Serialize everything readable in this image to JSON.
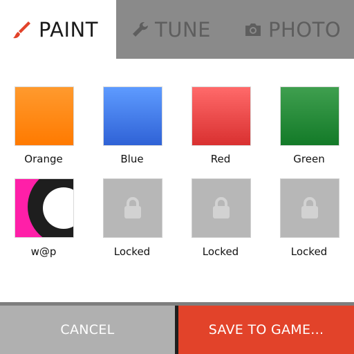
{
  "tabs": [
    {
      "label": "PAINT",
      "icon": "brush-icon",
      "active": true
    },
    {
      "label": "TUNE",
      "icon": "wrench-icon",
      "active": false
    },
    {
      "label": "PHOTO",
      "icon": "camera-icon",
      "active": false
    }
  ],
  "swatches": [
    {
      "label": "Orange",
      "color": "#ff8a12"
    },
    {
      "label": "Blue",
      "color": "#4a7ff0"
    },
    {
      "label": "Red",
      "color": "#ee4a4a"
    },
    {
      "label": "Green",
      "color": "#2a8c3a"
    },
    {
      "label": "w@p",
      "color": "#ff1fa8"
    },
    {
      "label": "Locked",
      "icon": "lock-icon"
    },
    {
      "label": "Locked",
      "icon": "lock-icon"
    },
    {
      "label": "Locked",
      "icon": "lock-icon"
    }
  ],
  "buttons": {
    "cancel": "CANCEL",
    "save": "SAVE TO GAME..."
  },
  "colors": {
    "accent": "#e2432a",
    "tabbar": "#8a8a8a",
    "locked": "#b7b7b7"
  }
}
